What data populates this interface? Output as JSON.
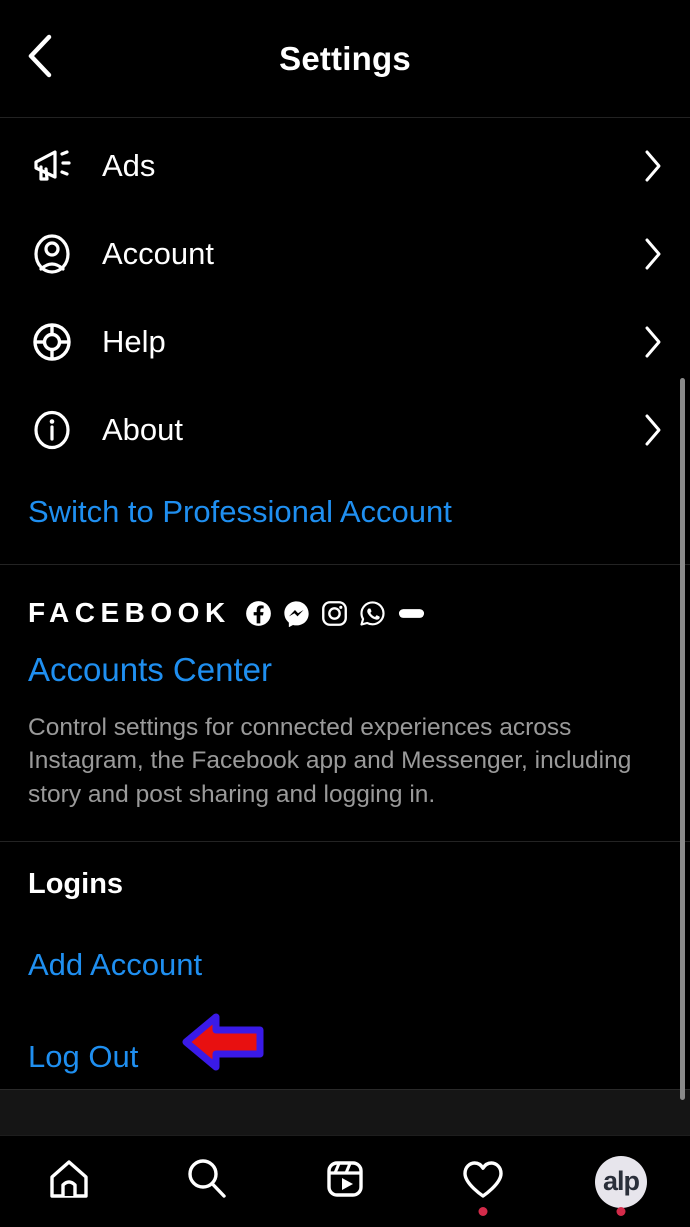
{
  "header": {
    "title": "Settings",
    "back_icon": "chevron-left-icon"
  },
  "settings_rows": [
    {
      "label": "Ads",
      "icon": "megaphone-icon",
      "chevron": "chevron-right-icon"
    },
    {
      "label": "Account",
      "icon": "person-circle-icon",
      "chevron": "chevron-right-icon"
    },
    {
      "label": "Help",
      "icon": "life-preserver-icon",
      "chevron": "chevron-right-icon"
    },
    {
      "label": "About",
      "icon": "info-circle-icon",
      "chevron": "chevron-right-icon"
    }
  ],
  "switch_professional": {
    "label": "Switch to Professional Account"
  },
  "facebook_section": {
    "brand_word": "FACEBOOK",
    "app_icons": [
      "facebook-icon",
      "messenger-icon",
      "instagram-icon",
      "whatsapp-icon",
      "oculus-icon"
    ],
    "accounts_center_label": "Accounts Center",
    "description": "Control settings for connected experiences across Instagram, the Facebook app and Messenger, including story and post sharing and logging in."
  },
  "logins_section": {
    "title": "Logins",
    "add_account_label": "Add Account",
    "log_out_label": "Log Out"
  },
  "annotation": {
    "shape": "left-arrow-annotation",
    "fill_color": "#e81010",
    "outline_color": "#3a1ae8"
  },
  "bottom_nav": [
    {
      "icon": "home-icon",
      "badge": false
    },
    {
      "icon": "search-icon",
      "badge": false
    },
    {
      "icon": "reels-icon",
      "badge": false
    },
    {
      "icon": "heart-icon",
      "badge": true
    },
    {
      "icon": "avatar-icon",
      "badge": true,
      "avatar_text": "alp"
    }
  ],
  "colors": {
    "background": "#000000",
    "link_blue": "#1f8ff0",
    "text_white": "#ffffff",
    "text_muted": "#9a9a9a",
    "badge_red": "#d32b4a"
  }
}
